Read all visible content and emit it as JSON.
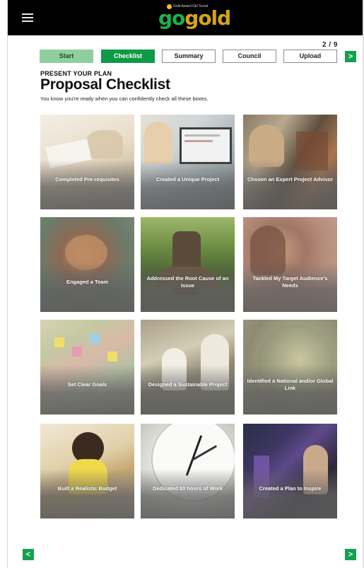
{
  "header": {
    "menu_icon": "hamburger-menu-icon",
    "logo_small_text": "Gold Award Girl Scout",
    "logo_go": "go",
    "logo_gold": "gold"
  },
  "progress": {
    "page_count": "2 / 9",
    "steps": [
      {
        "label": "Start",
        "state": "done"
      },
      {
        "label": "Checklist",
        "state": "active"
      },
      {
        "label": "Summary",
        "state": "todo"
      },
      {
        "label": "Council",
        "state": "todo"
      },
      {
        "label": "Upload",
        "state": "todo"
      }
    ],
    "next_icon": ">"
  },
  "content": {
    "eyebrow": "PRESENT YOUR PLAN",
    "title": "Proposal Checklist",
    "subtitle": "You know you're ready when you can confidently check all these boxes."
  },
  "cards": [
    {
      "label": "Completed Pre-requisites"
    },
    {
      "label": "Created a Unique Project"
    },
    {
      "label": "Chosen an Expert Project Advisor"
    },
    {
      "label": "Engaged a Team"
    },
    {
      "label": "Addressed the Root Cause of an Issue"
    },
    {
      "label": "Tackled My Target Audience's Needs"
    },
    {
      "label": "Set Clear Goals"
    },
    {
      "label": "Designed a Sustainable Project"
    },
    {
      "label": "Identified a National and/or Global Link"
    },
    {
      "label": "Built a Realistic Budget"
    },
    {
      "label": "Dedicated 80 hours of Work"
    },
    {
      "label": "Created a Plan to Inspire"
    }
  ],
  "footer": {
    "prev_icon": "<",
    "next_icon": ">"
  },
  "colors": {
    "brand_green": "#13a14f",
    "step_done": "#8fcf9f",
    "brand_gold": "#d4a514"
  }
}
